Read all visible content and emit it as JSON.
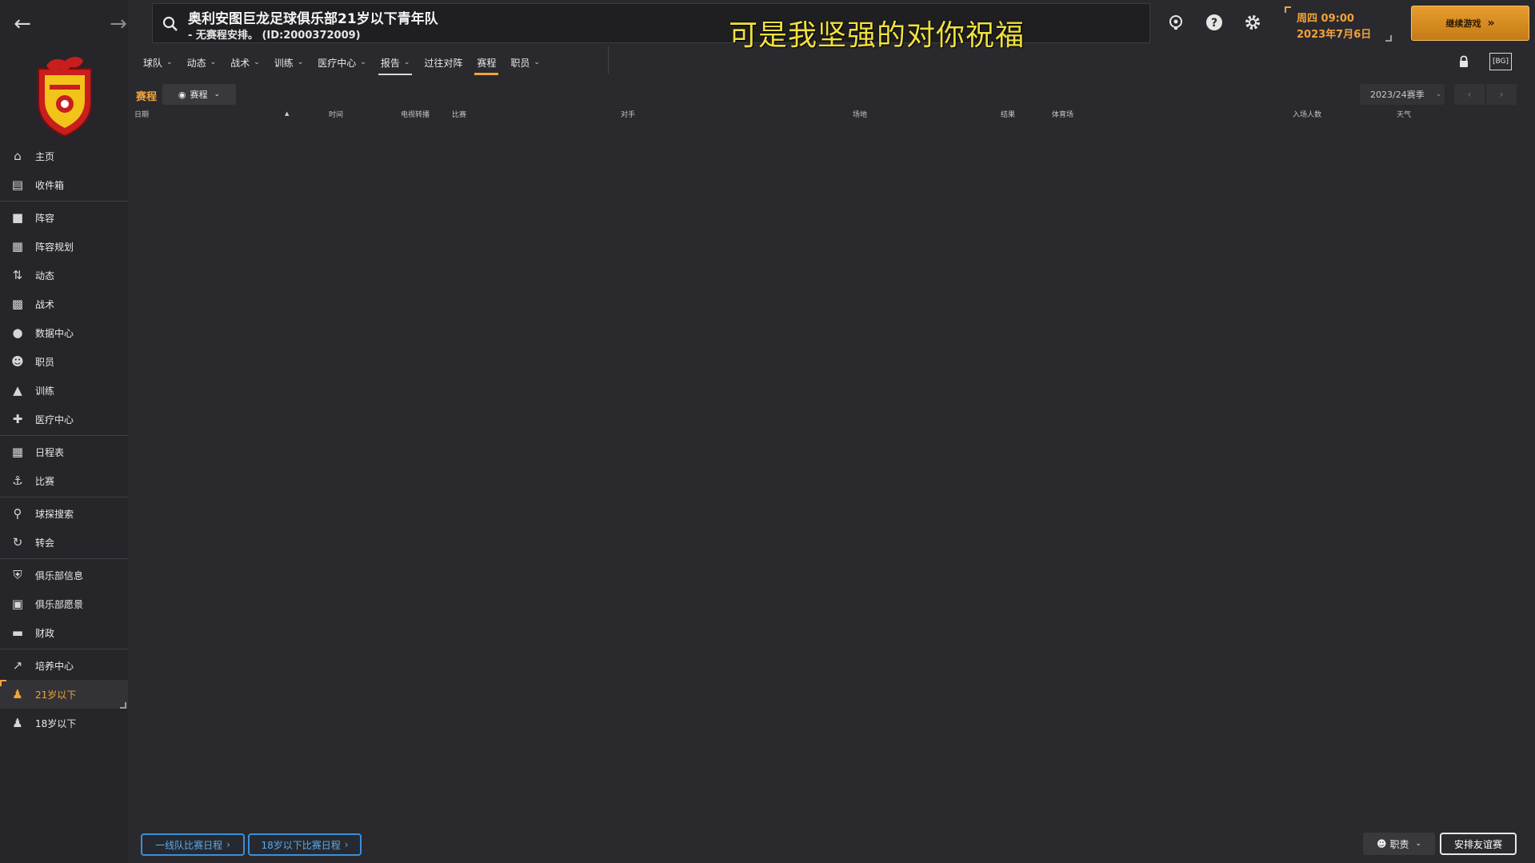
{
  "nav": {
    "back_icon": "arrow-left-icon",
    "forward_icon": "arrow-right-icon"
  },
  "sidebar": {
    "items": [
      {
        "label": "主页",
        "icon": "home-icon"
      },
      {
        "label": "收件箱",
        "icon": "inbox-icon"
      },
      {
        "label": "阵容",
        "icon": "shirt-icon"
      },
      {
        "label": "阵容规划",
        "icon": "clipboard-icon"
      },
      {
        "label": "动态",
        "icon": "dynamics-icon"
      },
      {
        "label": "战术",
        "icon": "tactics-icon"
      },
      {
        "label": "数据中心",
        "icon": "data-circle-icon"
      },
      {
        "label": "职员",
        "icon": "staff-icon"
      },
      {
        "label": "训练",
        "icon": "training-icon"
      },
      {
        "label": "医疗中心",
        "icon": "medical-icon"
      },
      {
        "label": "日程表",
        "icon": "calendar-icon"
      },
      {
        "label": "比赛",
        "icon": "trophy-icon"
      },
      {
        "label": "球探搜索",
        "icon": "scout-search-icon"
      },
      {
        "label": "转会",
        "icon": "transfer-icon"
      },
      {
        "label": "俱乐部信息",
        "icon": "shield-icon"
      },
      {
        "label": "俱乐部愿景",
        "icon": "vision-icon"
      },
      {
        "label": "财政",
        "icon": "finance-icon"
      },
      {
        "label": "培养中心",
        "icon": "development-icon"
      },
      {
        "label": "21岁以下",
        "icon": "u21-icon"
      },
      {
        "label": "18岁以下",
        "icon": "u18-icon"
      }
    ]
  },
  "search": {
    "title": "奥利安图巨龙足球俱乐部21岁以下青年队",
    "subtitle": "- 无赛程安排。 (ID:2000372009)"
  },
  "caption": "可是我坚强的对你祝福",
  "topbar": {
    "date_line1": "周四 09:00",
    "date_line2": "2023年7月6日",
    "continue_label": "继续游戏",
    "fit_label": "[BG]"
  },
  "tabs": [
    {
      "label": "球队",
      "dropdown": true
    },
    {
      "label": "动态",
      "dropdown": true
    },
    {
      "label": "战术",
      "dropdown": true
    },
    {
      "label": "训练",
      "dropdown": true
    },
    {
      "label": "医疗中心",
      "dropdown": true
    },
    {
      "label": "报告",
      "dropdown": true
    },
    {
      "label": "过往对阵",
      "dropdown": false
    },
    {
      "label": "赛程",
      "dropdown": false
    },
    {
      "label": "职员",
      "dropdown": true
    }
  ],
  "section": {
    "title": "赛程",
    "view_label": "赛程",
    "season": "2023/24赛季"
  },
  "table": {
    "headers": [
      "日期",
      "时间",
      "电视转播",
      "比赛",
      "对手",
      "场地",
      "结果",
      "体育场",
      "入场人数",
      "天气"
    ]
  },
  "bottom": {
    "first_team_btn": "一线队比赛日程",
    "u18_btn": "18岁以下比赛日程",
    "duty_btn": "职责",
    "friendly_btn": "安排友谊赛"
  },
  "colors": {
    "accent": "#f2a33a",
    "link": "#3b8fd8",
    "background": "#2a2a2e"
  }
}
